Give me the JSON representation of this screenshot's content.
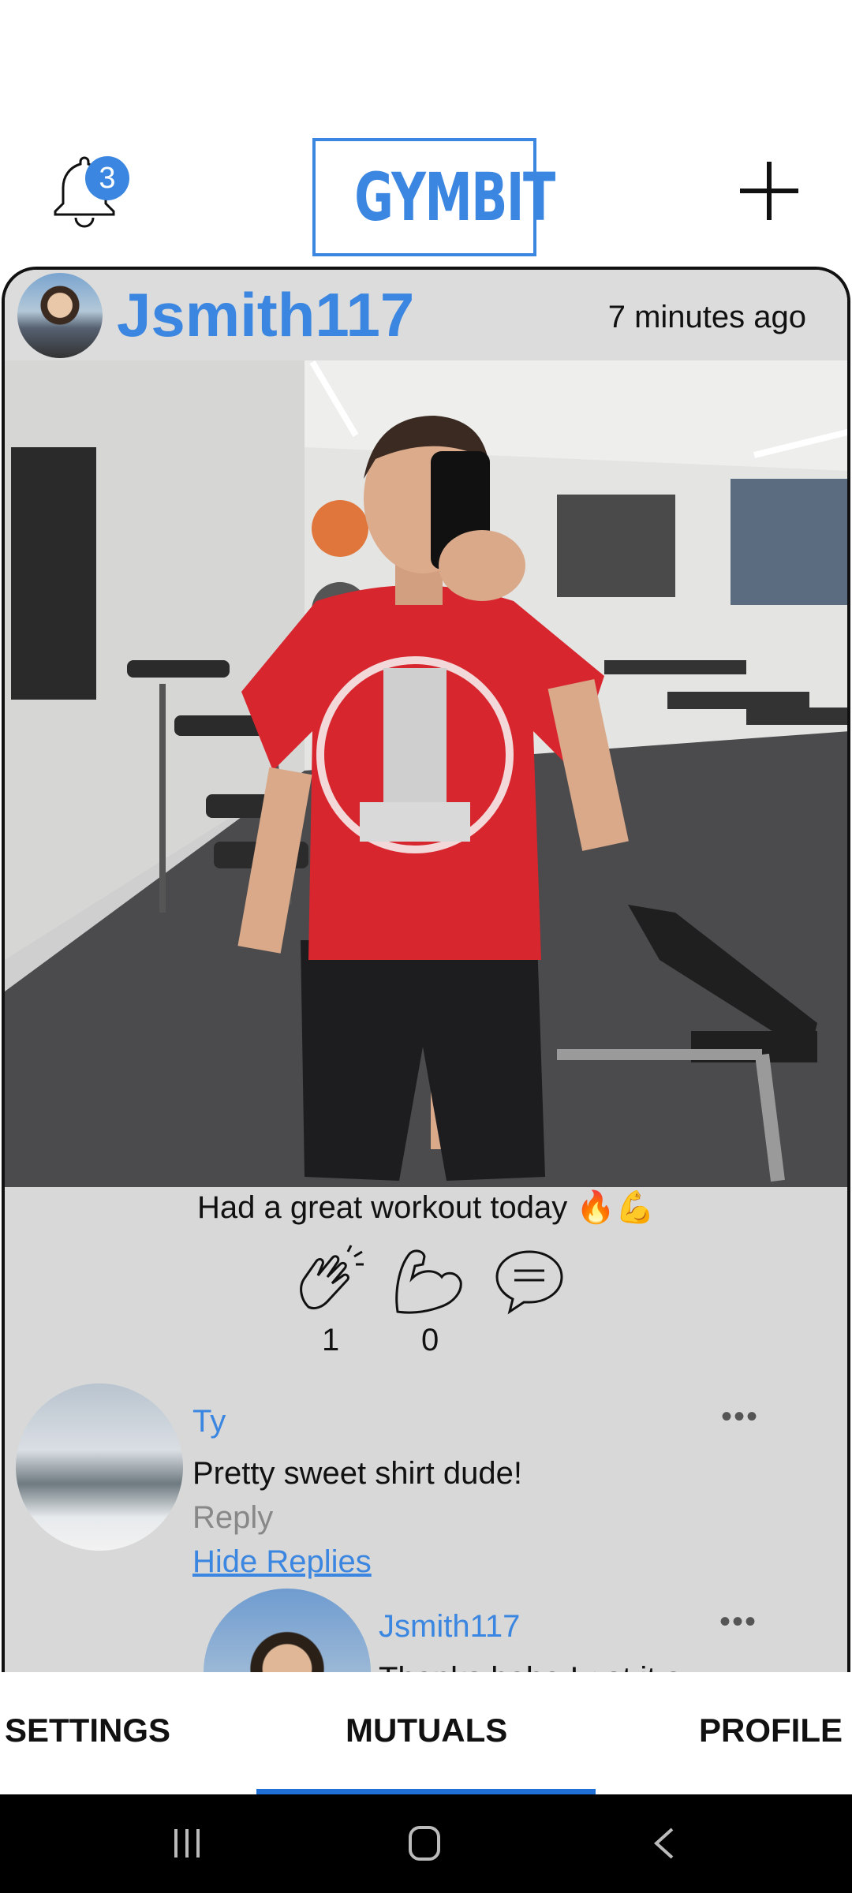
{
  "header": {
    "logo_text": "GYMBIT",
    "notification_count": "3",
    "accent_color": "#3a86e0"
  },
  "post": {
    "username": "Jsmith117",
    "timestamp": "7 minutes ago",
    "caption": "Had a great workout today 🔥💪",
    "reactions": [
      {
        "icon": "clap-icon",
        "count": "1"
      },
      {
        "icon": "flex-icon",
        "count": "0"
      },
      {
        "icon": "comment-icon"
      }
    ]
  },
  "comments": [
    {
      "author": "Ty",
      "text": "Pretty sweet shirt dude!",
      "reply_label": "Reply",
      "hide_replies_label": "Hide Replies",
      "more_icon": "more-dots-icon"
    }
  ],
  "replies": [
    {
      "author": "Jsmith117",
      "text": "Thanks haha I got it a",
      "more_icon": "more-dots-icon"
    }
  ],
  "bottom_nav": {
    "items": [
      "SETTINGS",
      "MUTUALS",
      "PROFILE"
    ],
    "active": "MUTUALS",
    "active_color": "#1f6fd6"
  }
}
